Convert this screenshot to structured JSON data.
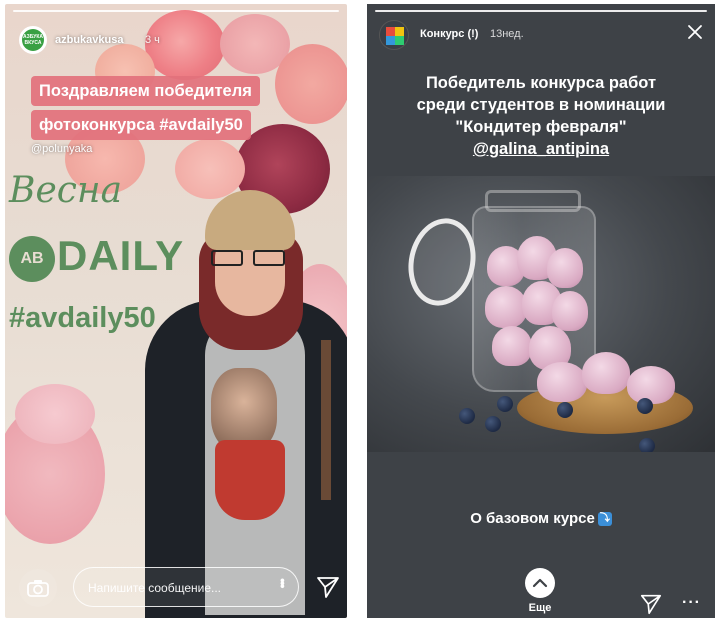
{
  "left_story": {
    "username": "azbukavkusa",
    "time": "3 ч",
    "avatar_text": "Азбука вкуса",
    "congrats_line1": "Поздравляем победителя",
    "congrats_line2": "фотоконкурса #avdaily50",
    "mention": "@polunyaka",
    "backdrop_script": "Весна",
    "backdrop_logo": "DAILY",
    "backdrop_hashtag": "#avdaily50",
    "message_placeholder": "Напишите сообщение...",
    "icons": [
      "camera-icon",
      "more-vertical-icon",
      "send-icon"
    ]
  },
  "right_story": {
    "username": "Конкурс (!)",
    "time": "13нед.",
    "text_line1": "Победитель конкурса работ",
    "text_line2": "среди студентов в номинации",
    "text_line3": "\"Кондитер февраля\"",
    "mention": "@galina_antipina",
    "link_text": "О базовом курсе",
    "link_icon": "⤵",
    "see_more_label": "Еще",
    "icons": [
      "close-icon",
      "chevron-up-icon",
      "send-icon",
      "more-horizontal-icon"
    ]
  },
  "colors": {
    "congrats_bg": "#e2717c",
    "brand_green": "#5c8e5d",
    "right_bg": "#3e4247"
  }
}
